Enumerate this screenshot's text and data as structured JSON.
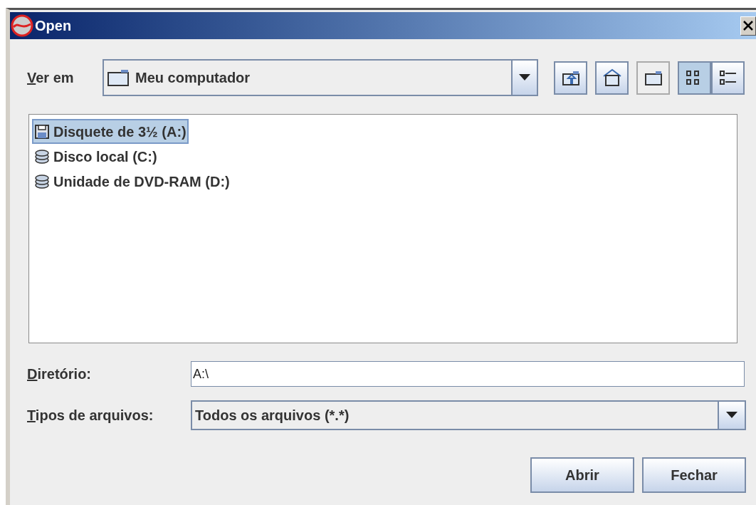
{
  "window": {
    "title": "Open"
  },
  "look_in": {
    "label": "Ver em",
    "mnemonic": true,
    "value": "Meu computador"
  },
  "toolbar": [
    {
      "kind": "up",
      "selected": false,
      "disabled": false
    },
    {
      "kind": "home",
      "selected": false,
      "disabled": false
    },
    {
      "kind": "new-folder",
      "selected": false,
      "disabled": true
    },
    {
      "kind": "list",
      "selected": true,
      "disabled": false
    },
    {
      "kind": "details",
      "selected": false,
      "disabled": false
    }
  ],
  "files": [
    {
      "kind": "floppy",
      "name": "Disquete de 3½ (A:)",
      "selected": true
    },
    {
      "kind": "disk",
      "name": "Disco local (C:)",
      "selected": false
    },
    {
      "kind": "disk",
      "name": "Unidade de DVD-RAM (D:)",
      "selected": false
    }
  ],
  "directory": {
    "label": "Diretório:",
    "mnemonic": true,
    "value": "A:\\"
  },
  "file_types": {
    "label": "Tipos de arquivos:",
    "mnemonic": true,
    "value": "Todos os arquivos (*.*)"
  },
  "buttons": [
    "Abrir",
    "Fechar"
  ]
}
